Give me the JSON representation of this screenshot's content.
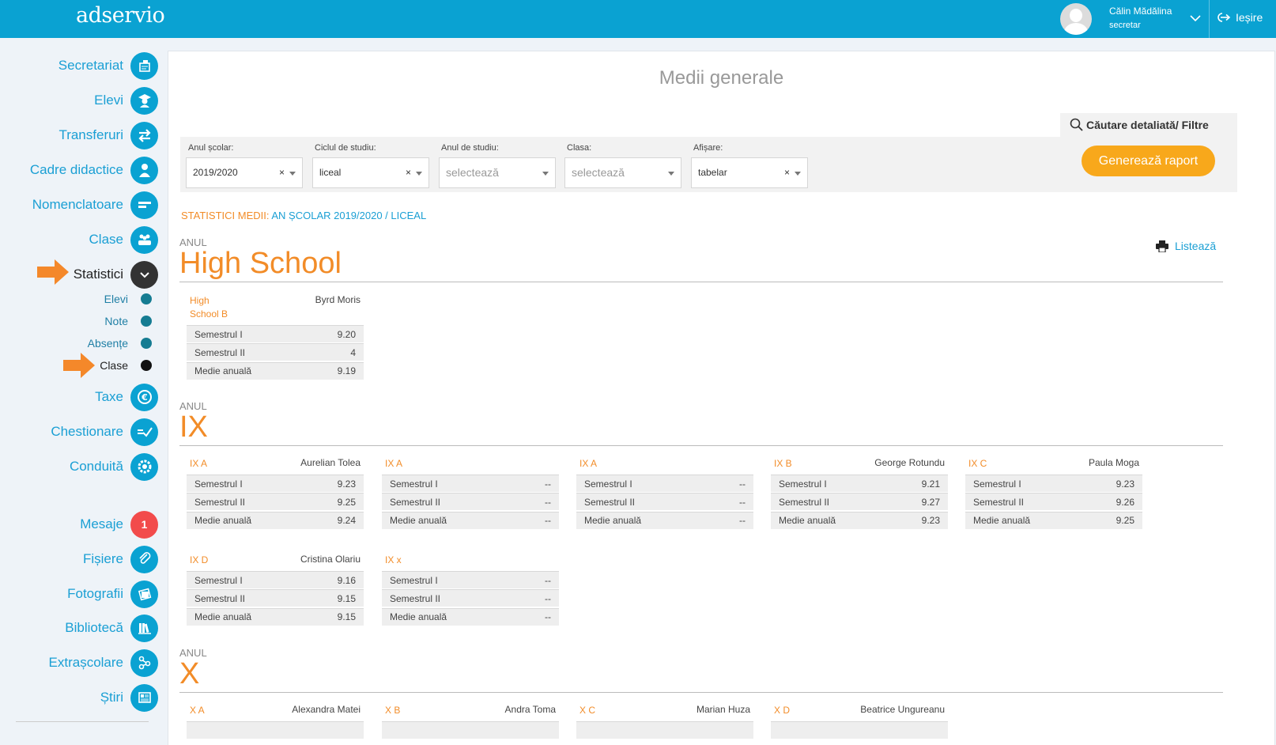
{
  "app": {
    "logo": "adservio"
  },
  "user": {
    "name": "Călin Mădălina",
    "role": "secretar",
    "logout_label": "Ieșire"
  },
  "sidebar": {
    "items": [
      {
        "label": "Secretariat",
        "icon": "secretariat-icon"
      },
      {
        "label": "Elevi",
        "icon": "student-icon"
      },
      {
        "label": "Transferuri",
        "icon": "transfer-icon"
      },
      {
        "label": "Cadre didactice",
        "icon": "teacher-icon"
      },
      {
        "label": "Nomenclatoare",
        "icon": "list-icon"
      },
      {
        "label": "Clase",
        "icon": "classes-icon"
      },
      {
        "label": "Statistici",
        "icon": "chevron-down-icon",
        "active": true
      },
      {
        "label": "Taxe",
        "icon": "euro-icon"
      },
      {
        "label": "Chestionare",
        "icon": "survey-icon"
      },
      {
        "label": "Conduită",
        "icon": "badge-icon"
      },
      {
        "label": "Mesaje",
        "badge": "1"
      },
      {
        "label": "Fișiere",
        "icon": "paperclip-icon"
      },
      {
        "label": "Fotografii",
        "icon": "photo-icon"
      },
      {
        "label": "Bibliotecă",
        "icon": "library-icon"
      },
      {
        "label": "Extrașcolare",
        "icon": "activity-icon"
      },
      {
        "label": "Știri",
        "icon": "news-icon"
      }
    ],
    "subitems": [
      {
        "label": "Elevi"
      },
      {
        "label": "Note"
      },
      {
        "label": "Absențe"
      },
      {
        "label": "Clase",
        "active": true
      }
    ]
  },
  "page": {
    "title": "Medii generale"
  },
  "search": {
    "label": "Căutare detaliată/ Filtre"
  },
  "filters": [
    {
      "label": "Anul școlar:",
      "value": "2019/2020",
      "clearable": true
    },
    {
      "label": "Ciclul de studiu:",
      "value": "liceal",
      "clearable": true
    },
    {
      "label": "Anul de studiu:",
      "value": "selectează",
      "placeholder": true
    },
    {
      "label": "Clasa:",
      "value": "selectează",
      "placeholder": true
    },
    {
      "label": "Afișare:",
      "value": "tabelar",
      "clearable": true
    }
  ],
  "generate_button": "Generează raport",
  "stats_heading": {
    "prefix": "STATISTICI MEDII:",
    "value": "AN ȘCOLAR 2019/2020 / LICEAL"
  },
  "print_label": "Listează",
  "row_labels": {
    "s1": "Semestrul I",
    "s2": "Semestrul II",
    "annual": "Medie anuală"
  },
  "years": [
    {
      "prefix": "ANUL",
      "name": "High School",
      "classes": [
        {
          "class": "High School B",
          "teacher": "Byrd Moris",
          "s1": "9.20",
          "s2": "4",
          "annual": "9.19"
        }
      ]
    },
    {
      "prefix": "ANUL",
      "name": "IX",
      "classes": [
        {
          "class": "IX A",
          "teacher": "Aurelian Tolea",
          "s1": "9.23",
          "s2": "9.25",
          "annual": "9.24"
        },
        {
          "class": "IX A",
          "teacher": "",
          "s1": "--",
          "s2": "--",
          "annual": "--"
        },
        {
          "class": "IX A",
          "teacher": "",
          "s1": "--",
          "s2": "--",
          "annual": "--"
        },
        {
          "class": "IX B",
          "teacher": "George Rotundu",
          "s1": "9.21",
          "s2": "9.27",
          "annual": "9.23"
        },
        {
          "class": "IX C",
          "teacher": "Paula Moga",
          "s1": "9.23",
          "s2": "9.26",
          "annual": "9.25"
        },
        {
          "class": "IX D",
          "teacher": "Cristina Olariu",
          "s1": "9.16",
          "s2": "9.15",
          "annual": "9.15"
        },
        {
          "class": "IX x",
          "teacher": "",
          "s1": "--",
          "s2": "--",
          "annual": "--"
        }
      ]
    },
    {
      "prefix": "ANUL",
      "name": "X",
      "classes": [
        {
          "class": "X A",
          "teacher": "Alexandra Matei"
        },
        {
          "class": "X B",
          "teacher": "Andra Toma"
        },
        {
          "class": "X C",
          "teacher": "Marian Huza"
        },
        {
          "class": "X D",
          "teacher": "Beatrice Ungureanu"
        }
      ]
    }
  ]
}
